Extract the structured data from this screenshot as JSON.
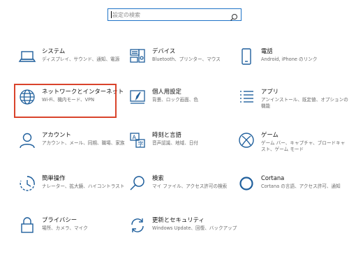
{
  "search": {
    "placeholder": "設定の検索"
  },
  "tiles": [
    {
      "title": "システム",
      "desc": "ディスプレイ、サウンド、通知、電源",
      "icon": "laptop-icon"
    },
    {
      "title": "デバイス",
      "desc": "Bluetooth、プリンター、マウス",
      "icon": "keyboard-devices-icon"
    },
    {
      "title": "電話",
      "desc": "Android, iPhone のリンク",
      "icon": "phone-icon"
    },
    {
      "title": "ネットワークとインターネット",
      "desc": "Wi-Fi、機内モード、VPN",
      "icon": "globe-icon"
    },
    {
      "title": "個人用設定",
      "desc": "背景、ロック画面、色",
      "icon": "personalization-icon"
    },
    {
      "title": "アプリ",
      "desc": "アンインストール、既定値、オプションの機能",
      "icon": "apps-list-icon"
    },
    {
      "title": "アカウント",
      "desc": "アカウント、メール、同期、職場、家族",
      "icon": "person-icon"
    },
    {
      "title": "時刻と言語",
      "desc": "音声認識、地域、日付",
      "icon": "time-language-icon"
    },
    {
      "title": "ゲーム",
      "desc": "ゲーム バー、キャプチャ、ブロードキャスト、ゲーム モード",
      "icon": "xbox-icon"
    },
    {
      "title": "簡単操作",
      "desc": "ナレーター、拡大鏡、ハイコントラスト",
      "icon": "ease-of-access-icon"
    },
    {
      "title": "検索",
      "desc": "マイ ファイル、アクセス許可の検索",
      "icon": "search-icon"
    },
    {
      "title": "Cortana",
      "desc": "Cortana の言語、アクセス許可、通知",
      "icon": "cortana-icon"
    },
    {
      "title": "プライバシー",
      "desc": "場所、カメラ、マイク",
      "icon": "lock-icon"
    },
    {
      "title": "更新とセキュリティ",
      "desc": "Windows Update、回復、バックアップ",
      "icon": "update-icon"
    }
  ],
  "colors": {
    "accent": "#1f73c7",
    "highlight": "#d9432b",
    "icon": "#1f5f9c"
  }
}
